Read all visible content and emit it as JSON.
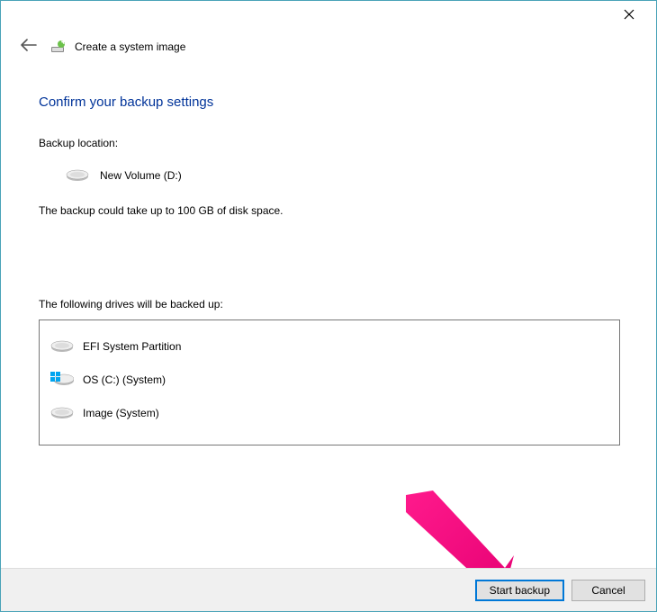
{
  "window": {
    "title": "Create a system image",
    "close_tooltip": "Close"
  },
  "main": {
    "heading": "Confirm your backup settings",
    "location_label": "Backup location:",
    "location_drive": "New Volume (D:)",
    "space_notice": "The backup could take up to 100 GB of disk space.",
    "drives_label": "The following drives will be backed up:",
    "drives": [
      {
        "label": "EFI System Partition",
        "icon": "hdd"
      },
      {
        "label": "OS (C:) (System)",
        "icon": "win-hdd"
      },
      {
        "label": "Image (System)",
        "icon": "hdd"
      }
    ]
  },
  "footer": {
    "primary_label": "Start backup",
    "cancel_label": "Cancel"
  }
}
